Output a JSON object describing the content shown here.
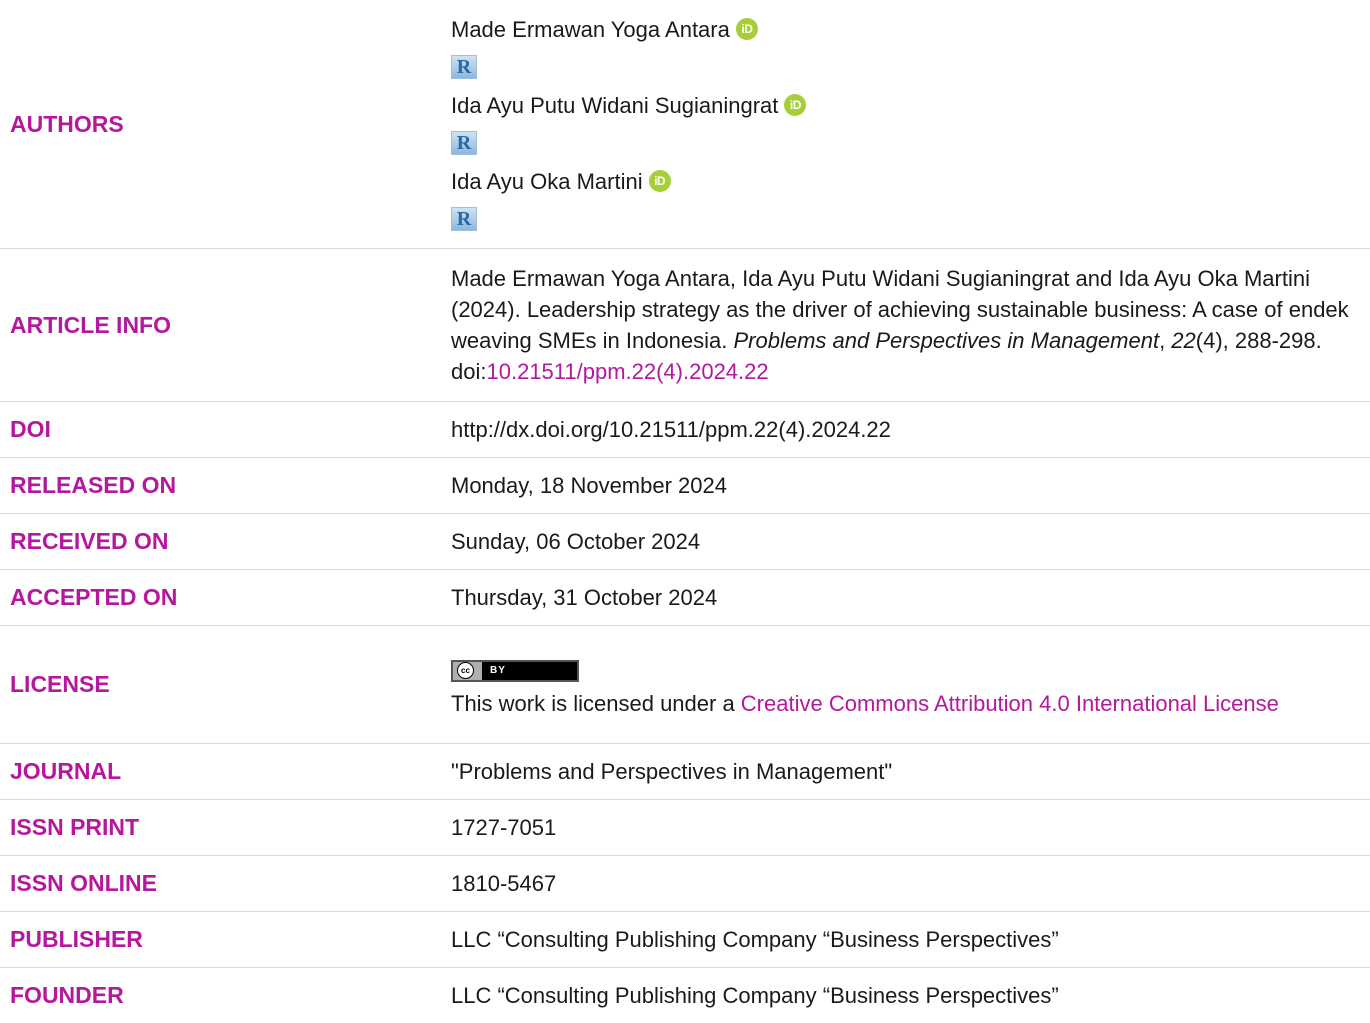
{
  "labels": {
    "authors": "AUTHORS",
    "article_info": "ARTICLE INFO",
    "doi": "DOI",
    "released_on": "RELEASED ON",
    "received_on": "RECEIVED ON",
    "accepted_on": "ACCEPTED ON",
    "license": "LICENSE",
    "journal": "JOURNAL",
    "issn_print": "ISSN PRINT",
    "issn_online": "ISSN ONLINE",
    "publisher": "PUBLISHER",
    "founder": "FOUNDER"
  },
  "authors": [
    {
      "name": "Made Ermawan Yoga Antara",
      "orcid_icon": "iD",
      "rg_icon": "R"
    },
    {
      "name": "Ida Ayu Putu Widani Sugianingrat",
      "orcid_icon": "iD",
      "rg_icon": "R"
    },
    {
      "name": "Ida Ayu Oka Martini",
      "orcid_icon": "iD",
      "rg_icon": "R"
    }
  ],
  "article_info": {
    "text1": "Made Ermawan Yoga Antara, Ida Ayu Putu Widani Sugianingrat and Ida Ayu Oka Martini (2024). Leadership strategy as the driver of achieving sustainable business: A case of endek weaving SMEs in Indonesia. ",
    "journal_italic": "Problems and Perspectives in Management",
    "sep1": ", ",
    "volume_italic": "22",
    "text2": "(4), 288-298. doi:",
    "doi_link": "10.21511/ppm.22(4).2024.22"
  },
  "doi": "http://dx.doi.org/10.21511/ppm.22(4).2024.22",
  "released_on": "Monday, 18 November 2024",
  "received_on": "Sunday, 06 October 2024",
  "accepted_on": "Thursday, 31 October 2024",
  "license": {
    "badge_cc": "cc",
    "badge_by": "BY",
    "text": "This work is licensed under a ",
    "link": "Creative Commons Attribution 4.0 International License"
  },
  "journal": "\"Problems and Perspectives in Management\"",
  "issn_print": "1727-7051",
  "issn_online": "1810-5467",
  "publisher": "LLC “Consulting Publishing Company “Business Perspectives”",
  "founder": "LLC “Consulting Publishing Company “Business Perspectives”",
  "colors": {
    "label": "#b5179e",
    "link": "#b5179e",
    "orcid": "#a6ce39"
  }
}
